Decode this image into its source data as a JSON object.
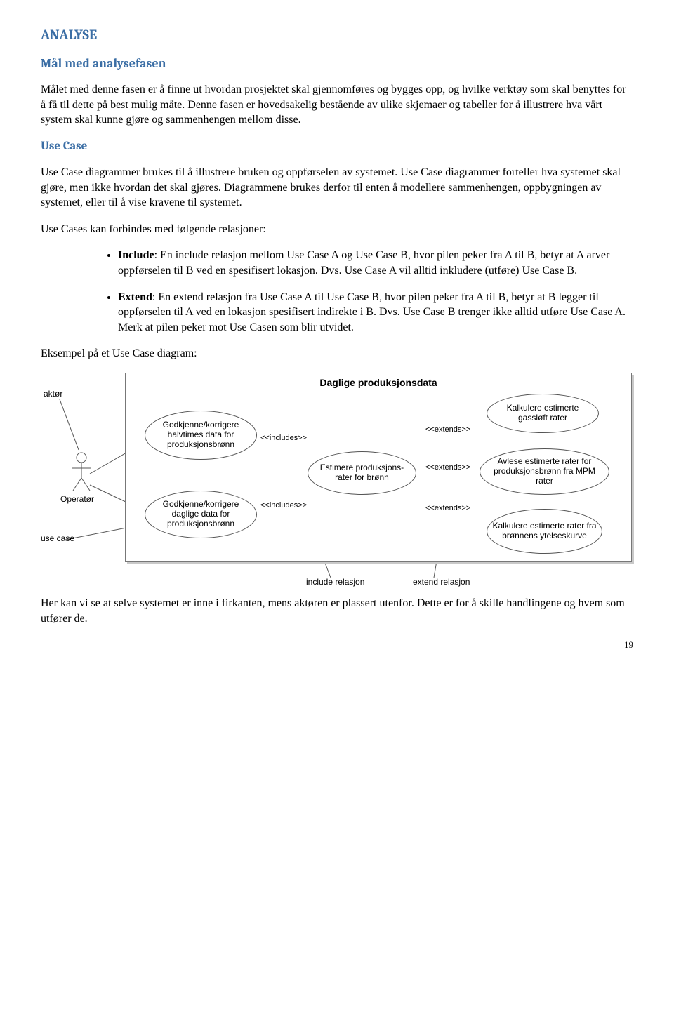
{
  "headings": {
    "h1": "ANALYSE",
    "h2": "Mål med analysefasen",
    "h3": "Use Case"
  },
  "paras": {
    "p1": "Målet med denne fasen er å finne ut hvordan prosjektet skal gjennomføres og bygges opp, og hvilke verktøy som skal benyttes for å få til dette på best mulig måte. Denne fasen er hovedsakelig bestående av ulike skjemaer og tabeller for å illustrere hva vårt system skal kunne gjøre og sammenhengen mellom disse.",
    "p2": "Use Case diagrammer brukes til å illustrere bruken og oppførselen av systemet. Use Case diagrammer forteller hva systemet skal gjøre, men ikke hvordan det skal gjøres. Diagrammene brukes derfor til enten å modellere sammenhengen, oppbygningen av systemet, eller til å vise kravene til systemet.",
    "p3": "Use Cases kan forbindes med følgende relasjoner:",
    "example_intro": "Eksempel på et Use Case diagram:",
    "p4": "Her kan vi se at selve systemet er inne i firkanten, mens aktøren er plassert utenfor. Dette er for å skille handlingene og hvem som utfører de."
  },
  "bullets": {
    "include_lead": "Include",
    "include_text": ": En include relasjon mellom Use Case A og Use Case B, hvor pilen peker fra A til B, betyr at A arver oppførselen til B ved en spesifisert lokasjon. Dvs. Use Case A vil alltid inkludere (utføre) Use Case B.",
    "extend_lead": "Extend",
    "extend_text": ": En extend relasjon fra Use Case A til Use Case B, hvor pilen peker fra A til B, betyr at B legger til oppførselen til A ved en lokasjon spesifisert indirekte i B. Dvs. Use Case B trenger ikke alltid utføre Use Case A. Merk at pilen peker mot Use Casen som blir utvidet."
  },
  "diagram": {
    "title": "Daglige produksjonsdata",
    "actor_label_top": "aktør",
    "actor_name": "Operatør",
    "usecase_legend": "use case",
    "include_legend": "include relasjon",
    "extend_legend": "extend relasjon",
    "inc_label": "<<includes>>",
    "ext_label": "<<extends>>",
    "uc1": "Godkjenne/korrigere halvtimes data for produksjonsbrønn",
    "uc2": "Godkjenne/korrigere daglige data for produksjonsbrønn",
    "uc_center": "Estimere produksjons- rater for brønn",
    "uc_r1": "Kalkulere estimerte gassløft rater",
    "uc_r2": "Avlese estimerte rater for produksjonsbrønn fra MPM rater",
    "uc_r3": "Kalkulere estimerte rater  fra brønnens ytelseskurve"
  },
  "page_number": "19"
}
